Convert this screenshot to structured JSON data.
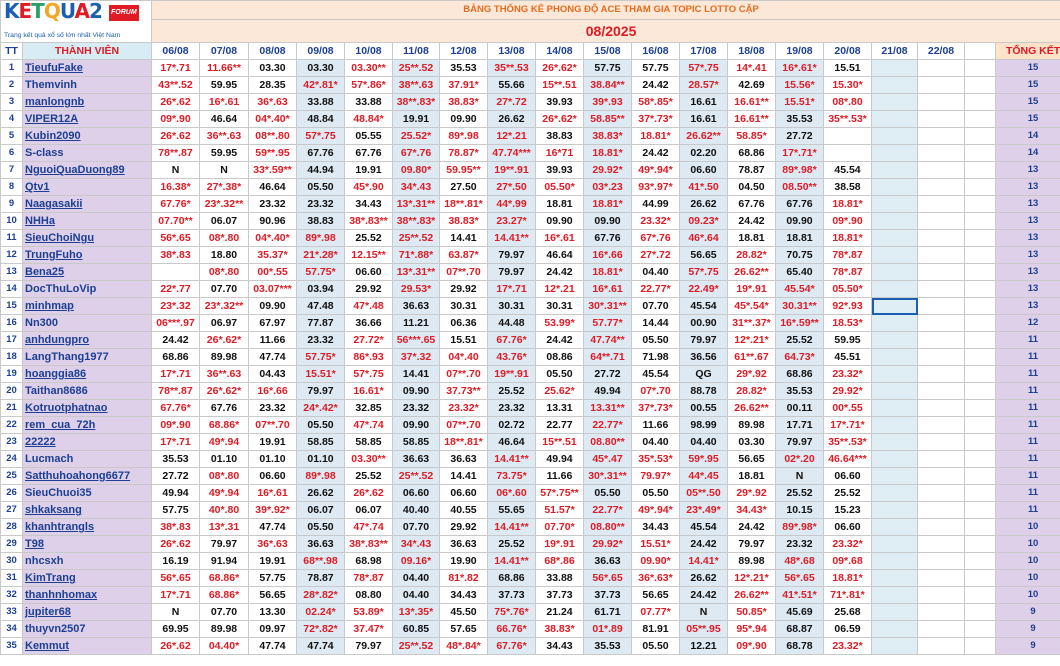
{
  "brand": {
    "logo_text": "KETQUA2",
    "forum_badge": "FORUM",
    "tagline": "Trang kết quả xổ số lớn nhất Việt Nam"
  },
  "sheet": {
    "subtitle": "BẢNG THỐNG KÊ PHONG ĐỘ ACE THAM GIA TOPIC  LOTTO CẶP",
    "month": "08/2025",
    "headers": {
      "tt": "TT",
      "member": "THÀNH VIÊN",
      "dates": [
        "06/08",
        "07/08",
        "08/08",
        "09/08",
        "10/08",
        "11/08",
        "12/08",
        "13/08",
        "14/08",
        "15/08",
        "16/08",
        "17/08",
        "18/08",
        "19/08",
        "20/08",
        "21/08",
        "22/08"
      ],
      "total": "TỔNG KẾT"
    },
    "rows": [
      {
        "tt": "1",
        "name": "TieufuFake",
        "cells": [
          "17*.71",
          "11.66**",
          "03.30",
          "03.30",
          "03.30**",
          "25**.52",
          "35.53",
          "35**.53",
          "26*.62*",
          "57.75",
          "57.75",
          "57*.75",
          "14*.41",
          "16*.61*",
          "15.51"
        ],
        "total": "15"
      },
      {
        "tt": "2",
        "name": "Themvinh",
        "cells": [
          "43**.52",
          "59.95",
          "28.35",
          "42*.81*",
          "57*.86*",
          "38**.63",
          "37.91*",
          "55.66",
          "15**.51",
          "38.84**",
          "24.42",
          "28.57*",
          "42.69",
          "15.56*",
          "15.30*"
        ],
        "total": "15"
      },
      {
        "tt": "3",
        "name": "manlongnb",
        "cells": [
          "26*.62",
          "16*.61",
          "36*.63",
          "33.88",
          "33.88",
          "38**.83*",
          "38.83*",
          "27*.72",
          "39.93",
          "39*.93",
          "58*.85*",
          "16.61",
          "16.61**",
          "15.51*",
          "08*.80"
        ],
        "total": "15"
      },
      {
        "tt": "4",
        "name": "VIPER12A",
        "cells": [
          "09*.90",
          "46.64",
          "04*.40*",
          "48.84",
          "48.84*",
          "19.91",
          "09.90",
          "26.62",
          "26*.62*",
          "58.85**",
          "37*.73*",
          "16.61",
          "16.61**",
          "35.53",
          "35**.53*"
        ],
        "total": "15"
      },
      {
        "tt": "5",
        "name": "Kubin2090",
        "cells": [
          "26*.62",
          "36**.63",
          "08**.80",
          "57*.75",
          "05.55",
          "25.52*",
          "89*.98",
          "12*.21",
          "38.83",
          "38.83*",
          "18.81*",
          "26.62**",
          "58.85*",
          "27.72"
        ],
        "total": "14"
      },
      {
        "tt": "6",
        "name": "S-class",
        "cells": [
          "78**.87",
          "59.95",
          "59**.95",
          "67.76",
          "67.76",
          "67*.76",
          "78.87*",
          "47.74***",
          "16*71",
          "18.81*",
          "24.42",
          "02.20",
          "68.86",
          "17*.71*"
        ],
        "total": "14"
      },
      {
        "tt": "7",
        "name": "NguoiQuaDuong89",
        "cells": [
          "N",
          "N",
          "33*.59**",
          "44.94",
          "19.91",
          "09.80*",
          "59.95**",
          "19**.91",
          "39.93",
          "29.92*",
          "49*.94*",
          "06.60",
          "78.87",
          "89*.98*",
          "45.54"
        ],
        "total": "13"
      },
      {
        "tt": "8",
        "name": "Qtv1",
        "cells": [
          "16.38*",
          "27*.38*",
          "46.64",
          "05.50",
          "45*.90",
          "34*.43",
          "27.50",
          "27*.50",
          "05.50*",
          "03*.23",
          "93*.97*",
          "41*.50",
          "04.50",
          "08.50**",
          "38.58"
        ],
        "total": "13"
      },
      {
        "tt": "9",
        "name": "Naagasakii",
        "cells": [
          "67.76*",
          "23*.32**",
          "23.32",
          "23.32",
          "34.43",
          "13*.31**",
          "18**.81*",
          "44*.99",
          "18.81",
          "18.81*",
          "44.99",
          "26.62",
          "67.76",
          "67.76",
          "18.81*"
        ],
        "total": "13"
      },
      {
        "tt": "10",
        "name": "NHHa",
        "cells": [
          "07.70**",
          "06.07",
          "90.96",
          "38.83",
          "38*.83**",
          "38**.83*",
          "38.83*",
          "23.27*",
          "09.90",
          "09.90",
          "23.32*",
          "09.23*",
          "24.42",
          "09.90",
          "09*.90"
        ],
        "total": "13"
      },
      {
        "tt": "11",
        "name": "SieuChoiNgu",
        "cells": [
          "56*.65",
          "08*.80",
          "04*.40*",
          "89*.98",
          "25.52",
          "25**.52",
          "14.41",
          "14.41**",
          "16*.61",
          "67.76",
          "67*.76",
          "46*.64",
          "18.81",
          "18.81",
          "18.81*"
        ],
        "total": "13"
      },
      {
        "tt": "12",
        "name": "TrungFuho",
        "cells": [
          "38*.83",
          "18.80",
          "35.37*",
          "21*.28*",
          "12.15**",
          "71*.88*",
          "63.87*",
          "79.97",
          "46.64",
          "16*.66",
          "27*.72",
          "56.65",
          "28.82*",
          "70.75",
          "78*.87"
        ],
        "total": "13"
      },
      {
        "tt": "13",
        "name": "Bena25",
        "cells": [
          "",
          "08*.80",
          "00*.55",
          "57.75*",
          "06.60",
          "13*.31**",
          "07**.70",
          "79.97",
          "24.42",
          "18.81*",
          "04.40",
          "57*.75",
          "26.62**",
          "65.40",
          "78*.87"
        ],
        "total": "13"
      },
      {
        "tt": "14",
        "name": "DocThuLoVip",
        "cells": [
          "22*.77",
          "07.70",
          "03.07***",
          "03.94",
          "29.92",
          "29.53*",
          "29.92",
          "17*.71",
          "12*.21",
          "16*.61",
          "22.77*",
          "22.49*",
          "19*.91",
          "45.54*",
          "05.50*"
        ],
        "total": "13"
      },
      {
        "tt": "15",
        "name": "minhmap",
        "cells": [
          "23*.32",
          "23*.32**",
          "09.90",
          "47.48",
          "47*.48",
          "36.63",
          "30.31",
          "30.31",
          "30.31",
          "30*.31**",
          "07.70",
          "45.54",
          "45*.54*",
          "30.31**",
          "92*.93"
        ],
        "total": "13"
      },
      {
        "tt": "16",
        "name": "Nn300",
        "cells": [
          "06***.97",
          "06.97",
          "67.97",
          "77.87",
          "36.66",
          "11.21",
          "06.36",
          "44.48",
          "53.99*",
          "57.77*",
          "14.44",
          "00.90",
          "31**.37*",
          "16*.59**",
          "18.53*"
        ],
        "total": "12"
      },
      {
        "tt": "17",
        "name": "anhdungpro",
        "cells": [
          "24.42",
          "26*.62*",
          "11.66",
          "23.32",
          "27.72*",
          "56***.65",
          "15.51",
          "67.76*",
          "24.42",
          "47.74**",
          "05.50",
          "79.97",
          "12*.21*",
          "25.52",
          "59.95"
        ],
        "total": "11"
      },
      {
        "tt": "18",
        "name": "LangThang1977",
        "cells": [
          "68.86",
          "89.98",
          "47.74",
          "57.75*",
          "86*.93",
          "37*.32",
          "04*.40",
          "43.76*",
          "08.86",
          "64**.71",
          "71.98",
          "36.56",
          "61**.67",
          "64.73*",
          "45.51"
        ],
        "total": "11"
      },
      {
        "tt": "19",
        "name": "hoanggia86",
        "cells": [
          "17*.71",
          "36**.63",
          "04.43",
          "15.51*",
          "57*.75",
          "14.41",
          "07**.70",
          "19**.91",
          "05.50",
          "27.72",
          "45.54",
          "QG",
          "29*.92",
          "68.86",
          "23.32*"
        ],
        "total": "11"
      },
      {
        "tt": "20",
        "name": "Taithan8686",
        "cells": [
          "78**.87",
          "26*.62*",
          "16*.66",
          "79.97",
          "16.61*",
          "09.90",
          "37.73**",
          "25.52",
          "25.62*",
          "49.94",
          "07*.70",
          "88.78",
          "28.82*",
          "35.53",
          "29.92*"
        ],
        "total": "11"
      },
      {
        "tt": "21",
        "name": "Kotruotphatnao",
        "cells": [
          "67.76*",
          "67.76",
          "23.32",
          "24*.42*",
          "32.85",
          "23.32",
          "23.32*",
          "23.32",
          "13.31",
          "13.31**",
          "37*.73*",
          "00.55",
          "26.62**",
          "00.11",
          "00*.55"
        ],
        "total": "11"
      },
      {
        "tt": "22",
        "name": "rem_cua_72h",
        "cells": [
          "09*.90",
          "68.86*",
          "07**.70",
          "05.50",
          "47*.74",
          "09.90",
          "07**.70",
          "02.72",
          "22.77",
          "22.77*",
          "11.66",
          "98.99",
          "89.98",
          "17.71",
          "17*.71*"
        ],
        "total": "11"
      },
      {
        "tt": "23",
        "name": "22222",
        "cells": [
          "17*.71",
          "49*.94",
          "19.91",
          "58.85",
          "58.85",
          "58.85",
          "18**.81*",
          "46.64",
          "15**.51",
          "08.80**",
          "04.40",
          "04.40",
          "03.30",
          "79.97",
          "35**.53*"
        ],
        "total": "11"
      },
      {
        "tt": "24",
        "name": "Lucmach",
        "cells": [
          "35.53",
          "01.10",
          "01.10",
          "01.10",
          "03.30**",
          "36.63",
          "36.63",
          "14.41**",
          "49.94",
          "45*.47",
          "35*.53*",
          "59*.95",
          "56.65",
          "02*.20",
          "46.64***"
        ],
        "total": "11"
      },
      {
        "tt": "25",
        "name": "Satthuhoahong6677",
        "cells": [
          "27.72",
          "08*.80",
          "06.60",
          "89*.98",
          "25.52",
          "25**.52",
          "14.41",
          "73.75*",
          "11.66",
          "30*.31**",
          "79.97*",
          "44*.45",
          "18.81",
          "N",
          "06.60"
        ],
        "total": "11"
      },
      {
        "tt": "26",
        "name": "SieuChuoi35",
        "cells": [
          "49.94",
          "49*.94",
          "16*.61",
          "26.62",
          "26*.62",
          "06.60",
          "06.60",
          "06*.60",
          "57*.75**",
          "05.50",
          "05.50",
          "05**.50",
          "29*.92",
          "25.52",
          "25.52"
        ],
        "total": "11"
      },
      {
        "tt": "27",
        "name": "shkaksang",
        "cells": [
          "57.75",
          "40*.80",
          "39*.92*",
          "06.07",
          "06.07",
          "40.40",
          "40.55",
          "55.65",
          "51.57*",
          "22.77*",
          "49*.94*",
          "23*.49*",
          "34.43*",
          "10.15",
          "15.23"
        ],
        "total": "11"
      },
      {
        "tt": "28",
        "name": "khanhtrangls",
        "cells": [
          "38*.83",
          "13*.31",
          "47.74",
          "05.50",
          "47*.74",
          "07.70",
          "29.92",
          "14.41**",
          "07.70*",
          "08.80**",
          "34.43",
          "45.54",
          "24.42",
          "89*.98*",
          "06.60"
        ],
        "total": "10"
      },
      {
        "tt": "29",
        "name": "T98",
        "cells": [
          "26*.62",
          "79.97",
          "36*.63",
          "36.63",
          "38*.83**",
          "34*.43",
          "36.63",
          "25.52",
          "19*.91",
          "29.92*",
          "15.51*",
          "24.42",
          "79.97",
          "23.32",
          "23.32*"
        ],
        "total": "10"
      },
      {
        "tt": "30",
        "name": "nhcsxh",
        "cells": [
          "16.19",
          "91.94",
          "19.91",
          "68**.98",
          "68.98",
          "09.16*",
          "19.90",
          "14.41**",
          "68*.86",
          "36.63",
          "09.90*",
          "14.41*",
          "89.98",
          "48*.68",
          "09*.68"
        ],
        "total": "10"
      },
      {
        "tt": "31",
        "name": "KimTrang",
        "cells": [
          "56*.65",
          "68.86*",
          "57.75",
          "78.87",
          "78*.87",
          "04.40",
          "81*.82",
          "68.86",
          "33.88",
          "56*.65",
          "36*.63*",
          "26.62",
          "12*.21*",
          "56*.65",
          "18.81*"
        ],
        "total": "10"
      },
      {
        "tt": "32",
        "name": "thanhnhomax",
        "cells": [
          "17*.71",
          "68.86*",
          "56.65",
          "28*.82*",
          "08.80",
          "04.40",
          "34.43",
          "37.73",
          "37.73",
          "37.73",
          "56.65",
          "24.42",
          "26.62**",
          "41*.51*",
          "71*.81*"
        ],
        "total": "10"
      },
      {
        "tt": "33",
        "name": "jupiter68",
        "cells": [
          "N",
          "07.70",
          "13.30",
          "02.24*",
          "53.89*",
          "13*.35*",
          "45.50",
          "75*.76*",
          "21.24",
          "61.71",
          "07.77*",
          "N",
          "50.85*",
          "45.69",
          "25.68"
        ],
        "total": "9"
      },
      {
        "tt": "34",
        "name": "thuyvn2507",
        "cells": [
          "69.95",
          "89.98",
          "09.97",
          "72*.82*",
          "37.47*",
          "60.85",
          "57.65",
          "66.76*",
          "38.83*",
          "01*.89",
          "81.91",
          "05**.95",
          "95*.94",
          "68.87",
          "06.59"
        ],
        "total": "9"
      },
      {
        "tt": "35",
        "name": "Kemmut",
        "cells": [
          "26*.62",
          "04.40*",
          "47.74",
          "47.74",
          "79.97",
          "25**.52",
          "48*.84*",
          "67.76*",
          "34.43",
          "35.53",
          "05.50",
          "12.21",
          "09*.90",
          "68.78",
          "23.32*"
        ],
        "total": "9"
      }
    ]
  },
  "colors": {
    "accent_red": "#e01b24",
    "header_blue": "#1c3f94",
    "name_bg": "#ddd0e8",
    "alt_blue": "#ddeaf4",
    "banner_bg": "#fce8d8"
  }
}
